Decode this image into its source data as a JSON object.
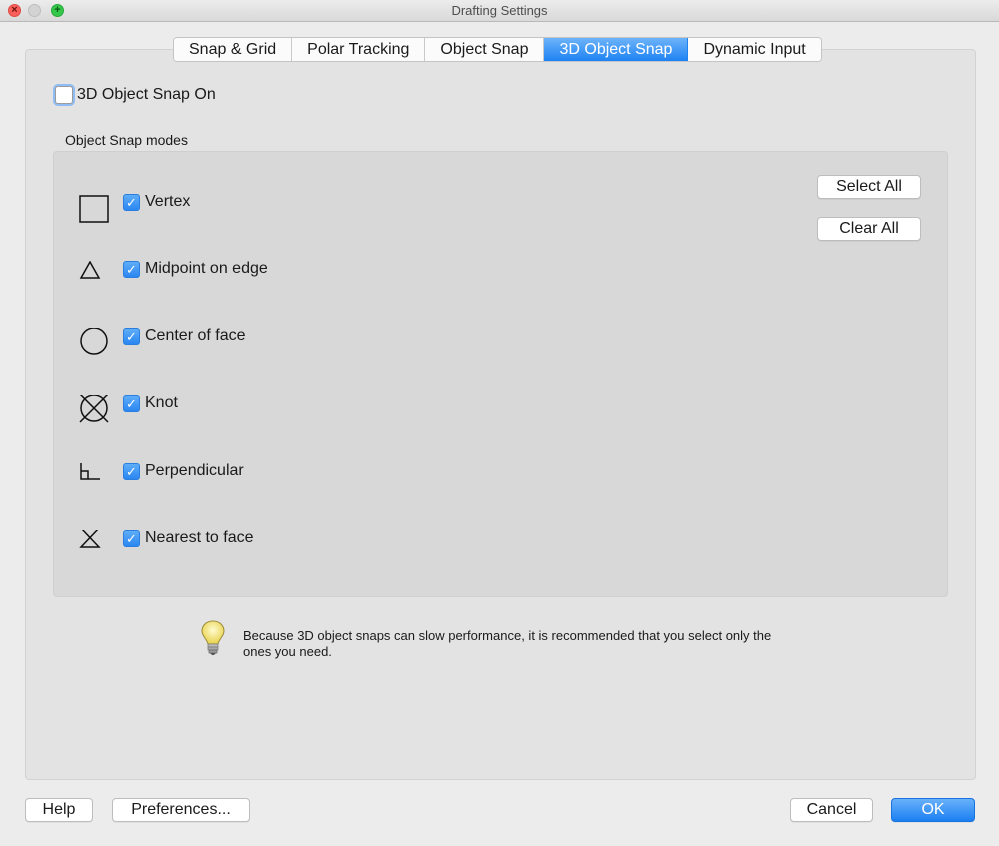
{
  "window": {
    "title": "Drafting Settings"
  },
  "tabs": [
    {
      "label": "Snap & Grid",
      "active": false
    },
    {
      "label": "Polar Tracking",
      "active": false
    },
    {
      "label": "Object Snap",
      "active": false
    },
    {
      "label": "3D Object Snap",
      "active": true
    },
    {
      "label": "Dynamic Input",
      "active": false
    }
  ],
  "master_toggle": {
    "label": "3D Object Snap On",
    "checked": false
  },
  "group": {
    "title": "Object Snap modes",
    "modes": [
      {
        "label": "Vertex",
        "icon": "square-icon",
        "checked": true
      },
      {
        "label": "Midpoint on edge",
        "icon": "triangle-icon",
        "checked": true
      },
      {
        "label": "Center of face",
        "icon": "circle-icon",
        "checked": true
      },
      {
        "label": "Knot",
        "icon": "circle-x-icon",
        "checked": true
      },
      {
        "label": "Perpendicular",
        "icon": "perpendicular-icon",
        "checked": true
      },
      {
        "label": "Nearest to face",
        "icon": "hourglass-icon",
        "checked": true
      }
    ],
    "select_all_label": "Select All",
    "clear_all_label": "Clear All"
  },
  "hint": {
    "icon": "lightbulb-icon",
    "text": "Because 3D object snaps can slow performance, it is recommended that you select only the ones you need."
  },
  "footer": {
    "help_label": "Help",
    "preferences_label": "Preferences...",
    "cancel_label": "Cancel",
    "ok_label": "OK"
  },
  "colors": {
    "accent": "#1e82f3",
    "close": "#fc605b",
    "zoom": "#34c84a"
  }
}
